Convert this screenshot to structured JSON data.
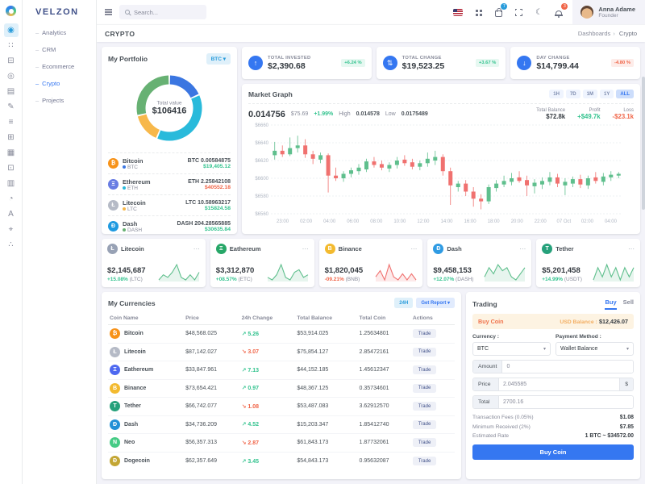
{
  "app": {
    "logo": "VELZON"
  },
  "ui": {
    "dots": "⋯",
    "chevron": "▾"
  },
  "topbar": {
    "search_placeholder": "Search...",
    "cart_badge": "7",
    "bell_badge": "3",
    "user": {
      "name": "Anna Adame",
      "role": "Founder"
    }
  },
  "sidebar": {
    "rail": [
      {
        "name": "dashboards-icon",
        "glyph": "◉",
        "state": "active"
      },
      {
        "name": "apps-icon",
        "glyph": "∷",
        "state": ""
      },
      {
        "name": "layouts-icon",
        "glyph": "⊟",
        "state": ""
      },
      {
        "name": "auth-icon",
        "glyph": "◎",
        "state": ""
      },
      {
        "name": "pages-icon",
        "glyph": "▤",
        "state": ""
      },
      {
        "name": "landing-icon",
        "glyph": "✎",
        "state": ""
      },
      {
        "name": "base-ui-icon",
        "glyph": "≡",
        "state": ""
      },
      {
        "name": "advance-ui-icon",
        "glyph": "⊞",
        "state": ""
      },
      {
        "name": "widgets-icon",
        "glyph": "▦",
        "state": ""
      },
      {
        "name": "forms-icon",
        "glyph": "⊡",
        "state": ""
      },
      {
        "name": "tables-icon",
        "glyph": "▥",
        "state": ""
      },
      {
        "name": "charts-icon",
        "glyph": "◔",
        "state": ""
      },
      {
        "name": "icons-icon",
        "glyph": "A",
        "state": ""
      },
      {
        "name": "maps-icon",
        "glyph": "⌖",
        "state": ""
      },
      {
        "name": "multilevel-icon",
        "glyph": "∴",
        "state": ""
      }
    ],
    "menu": [
      {
        "label": "Analytics",
        "state": ""
      },
      {
        "label": "CRM",
        "state": ""
      },
      {
        "label": "Ecommerce",
        "state": ""
      },
      {
        "label": "Crypto",
        "state": "active"
      },
      {
        "label": "Projects",
        "state": ""
      }
    ]
  },
  "page": {
    "title": "CRYPTO",
    "breadcrumb": [
      "Dashboards",
      "Crypto"
    ]
  },
  "portfolio": {
    "title": "My Portfolio",
    "selector": "BTC",
    "center_label": "Total value",
    "center_value": "$106416",
    "coins": [
      {
        "name": "Bitcoin",
        "symbol": "BTC",
        "icon": "₿",
        "icon_bg": "#f7931a",
        "dot": "#3b76e1",
        "amount": "BTC 0.00584875",
        "value": "$19,405.12",
        "state": "up"
      },
      {
        "name": "Ethereum",
        "symbol": "ETH",
        "icon": "Ξ",
        "icon_bg": "#687ce3",
        "dot": "#29badb",
        "amount": "ETH 2.25842108",
        "value": "$40552.18",
        "state": "down"
      },
      {
        "name": "Litecoin",
        "symbol": "LTC",
        "icon": "Ł",
        "icon_bg": "#b5bac6",
        "dot": "#f7b84b",
        "amount": "LTC 10.58963217",
        "value": "$15824.58",
        "state": "up"
      },
      {
        "name": "Dash",
        "symbol": "DASH",
        "icon": "Đ",
        "icon_bg": "#1f9ae0",
        "dot": "#67b173",
        "amount": "DASH 204.28565885",
        "value": "$30635.84",
        "state": "up"
      }
    ]
  },
  "stats": [
    {
      "icon": "↑",
      "label": "TOTAL INVESTED",
      "value": "$2,390.68",
      "badge": "+6.24 %",
      "state": "up"
    },
    {
      "icon": "⇅",
      "label": "TOTAL CHANGE",
      "value": "$19,523.25",
      "badge": "+3.67 %",
      "state": "up"
    },
    {
      "icon": "↓",
      "label": "DAY CHANGE",
      "value": "$14,799.44",
      "badge": "-4.80 %",
      "state": "down"
    }
  ],
  "market": {
    "title": "Market Graph",
    "ranges": [
      {
        "label": "1H",
        "state": ""
      },
      {
        "label": "7D",
        "state": ""
      },
      {
        "label": "1M",
        "state": ""
      },
      {
        "label": "1Y",
        "state": ""
      },
      {
        "label": "ALL",
        "state": "active"
      }
    ],
    "price": "0.014756",
    "usd": "$75.69",
    "change": "+1.99%",
    "high_label": "High",
    "high": "0.014578",
    "low_label": "Low",
    "low": "0.0175489",
    "total_balance_label": "Total Balance",
    "total_balance": "$72.8k",
    "profit_label": "Profit",
    "profit": "+$49.7k",
    "loss_label": "Loss",
    "loss": "-$23.1k"
  },
  "coin_cards": [
    {
      "name": "Litecoin",
      "icon": "Ł",
      "icon_bg": "#98a2b5",
      "value": "$2,145,687",
      "change": "+15.08%",
      "note": "(LTC)",
      "state": "up"
    },
    {
      "name": "Eathereum",
      "icon": "Ξ",
      "icon_bg": "#27a768",
      "value": "$3,312,870",
      "change": "+08.57%",
      "note": "(ETC)",
      "state": "up"
    },
    {
      "name": "Binance",
      "icon": "B",
      "icon_bg": "#f3ba2f",
      "value": "$1,820,045",
      "change": "-09.21%",
      "note": "(BNB)",
      "state": "down"
    },
    {
      "name": "Dash",
      "icon": "Đ",
      "icon_bg": "#2f9be3",
      "value": "$9,458,153",
      "change": "+12.07%",
      "note": "(DASH)",
      "state": "up"
    },
    {
      "name": "Tether",
      "icon": "T",
      "icon_bg": "#26a17b",
      "value": "$5,201,458",
      "change": "+14.99%",
      "note": "(USDT)",
      "state": "up"
    }
  ],
  "currencies": {
    "title": "My Currencies",
    "filter_label": "24H",
    "report_label": "Get Report ▾",
    "columns": [
      "Coin Name",
      "Price",
      "24h Change",
      "Total Balance",
      "Total Coin",
      "Actions"
    ],
    "action_label": "Trade",
    "rows": [
      {
        "name": "Bitcoin",
        "icon": "₿",
        "icon_bg": "#f7931a",
        "price": "$48,568.025",
        "change": "↗ 5.26",
        "state": "up",
        "balance": "$53,914.025",
        "coin": "1.25634801"
      },
      {
        "name": "Litecoin",
        "icon": "Ł",
        "icon_bg": "#b5bac6",
        "price": "$87,142.027",
        "change": "↘ 3.07",
        "state": "down",
        "balance": "$75,854.127",
        "coin": "2.85472161"
      },
      {
        "name": "Eathereum",
        "icon": "Ξ",
        "icon_bg": "#4d68f0",
        "price": "$33,847.961",
        "change": "↗ 7.13",
        "state": "up",
        "balance": "$44,152.185",
        "coin": "1.45612347"
      },
      {
        "name": "Binance",
        "icon": "B",
        "icon_bg": "#f3ba2f",
        "price": "$73,654.421",
        "change": "↗ 0.97",
        "state": "up",
        "balance": "$48,367.125",
        "coin": "0.35734601"
      },
      {
        "name": "Tether",
        "icon": "T",
        "icon_bg": "#26a17b",
        "price": "$66,742.077",
        "change": "↘ 1.08",
        "state": "down",
        "balance": "$53,487.083",
        "coin": "3.62912570"
      },
      {
        "name": "Dash",
        "icon": "Đ",
        "icon_bg": "#2290d6",
        "price": "$34,736.209",
        "change": "↗ 4.52",
        "state": "up",
        "balance": "$15,203.347",
        "coin": "1.85412740"
      },
      {
        "name": "Neo",
        "icon": "N",
        "icon_bg": "#45cb85",
        "price": "$56,357.313",
        "change": "↘ 2.87",
        "state": "down",
        "balance": "$61,843.173",
        "coin": "1.87732061"
      },
      {
        "name": "Dogecoin",
        "icon": "Ð",
        "icon_bg": "#c3a634",
        "price": "$62,357.649",
        "change": "↗ 3.45",
        "state": "up",
        "balance": "$54,843.173",
        "coin": "0.95632087"
      }
    ]
  },
  "trading": {
    "title": "Trading",
    "tabs": [
      {
        "label": "Buy",
        "state": "active"
      },
      {
        "label": "Sell",
        "state": ""
      }
    ],
    "banner_left": "Buy Coin",
    "balance_label": "USD Balance :",
    "balance_value": "$12,426.07",
    "currency_label": "Currency :",
    "currency_value": "BTC",
    "payment_label": "Payment Method :",
    "payment_value": "Wallet Balance",
    "amount_label": "Amount",
    "amount_value": "0",
    "price_label": "Price",
    "price_value": "2.045585",
    "price_suffix": "$",
    "total_label": "Total",
    "total_value": "2700.16",
    "summary": [
      {
        "label": "Transaction Fees (0.05%)",
        "value": "$1.08"
      },
      {
        "label": "Minimum Received (2%)",
        "value": "$7.85"
      },
      {
        "label": "Estimated Rate",
        "value": "1 BTC ~ $34572.00"
      }
    ],
    "submit_label": "Buy Coin"
  },
  "chart_data": [
    {
      "id": "portfolio-donut",
      "type": "pie",
      "title": "My Portfolio",
      "center_label": "Total value",
      "center_value": "$106416",
      "labels": [
        "Bitcoin",
        "Ethereum",
        "Litecoin",
        "Dash"
      ],
      "values": [
        19405.12,
        40552.18,
        15824.58,
        30635.84
      ],
      "colors": [
        "#3b76e1",
        "#29badb",
        "#f7b84b",
        "#67b173"
      ]
    },
    {
      "id": "market-candles",
      "type": "candlestick",
      "title": "Market Graph",
      "ylim": [
        6560,
        6660
      ],
      "ytick_values": [
        6560,
        6580,
        6600,
        6620,
        6640,
        6660
      ],
      "ytick_labels": [
        "$6560",
        "$6580",
        "$6600",
        "$6620",
        "$6640",
        "$6660"
      ],
      "xticks": [
        "23:00",
        "02:00",
        "04:00",
        "06:00",
        "08:00",
        "10:00",
        "12:00",
        "14:00",
        "16:00",
        "18:00",
        "20:00",
        "22:00",
        "07 Oct",
        "02:00",
        "04:00"
      ],
      "up_color": "#5fbf8d",
      "down_color": "#f0716f",
      "candles": [
        [
          6626,
          6641,
          6621,
          6631
        ],
        [
          6631,
          6637,
          6624,
          6627
        ],
        [
          6627,
          6646,
          6625,
          6634
        ],
        [
          6634,
          6648,
          6629,
          6637
        ],
        [
          6637,
          6644,
          6623,
          6627
        ],
        [
          6627,
          6631,
          6616,
          6622
        ],
        [
          6621,
          6629,
          6617,
          6626
        ],
        [
          6626,
          6628,
          6584,
          6603
        ],
        [
          6603,
          6612,
          6597,
          6600
        ],
        [
          6600,
          6608,
          6596,
          6605
        ],
        [
          6605,
          6612,
          6601,
          6609
        ],
        [
          6608,
          6616,
          6604,
          6612
        ],
        [
          6610,
          6622,
          6607,
          6619
        ],
        [
          6619,
          6624,
          6612,
          6615
        ],
        [
          6616,
          6620,
          6609,
          6612
        ],
        [
          6611,
          6618,
          6607,
          6615
        ],
        [
          6615,
          6624,
          6611,
          6620
        ],
        [
          6621,
          6626,
          6614,
          6617
        ],
        [
          6618,
          6622,
          6610,
          6613
        ],
        [
          6613,
          6620,
          6609,
          6617
        ],
        [
          6617,
          6629,
          6613,
          6622
        ],
        [
          6620,
          6631,
          6615,
          6624
        ],
        [
          6624,
          6627,
          6603,
          6608
        ],
        [
          6608,
          6612,
          6570,
          6592
        ],
        [
          6590,
          6597,
          6585,
          6594
        ],
        [
          6594,
          6598,
          6580,
          6585
        ],
        [
          6585,
          6590,
          6568,
          6577
        ],
        [
          6577,
          6582,
          6565,
          6574
        ],
        [
          6574,
          6593,
          6571,
          6590
        ],
        [
          6589,
          6598,
          6585,
          6594
        ],
        [
          6593,
          6603,
          6590,
          6597
        ],
        [
          6596,
          6606,
          6592,
          6600
        ],
        [
          6601,
          6608,
          6595,
          6597
        ],
        [
          6598,
          6603,
          6580,
          6592
        ],
        [
          6591,
          6599,
          6583,
          6595
        ],
        [
          6593,
          6601,
          6588,
          6597
        ],
        [
          6596,
          6607,
          6592,
          6601
        ],
        [
          6601,
          6605,
          6590,
          6594
        ],
        [
          6592,
          6600,
          6581,
          6596
        ],
        [
          6594,
          6602,
          6590,
          6599
        ],
        [
          6599,
          6604,
          6589,
          6593
        ],
        [
          6592,
          6603,
          6588,
          6600
        ],
        [
          6601,
          6607,
          6594,
          6597
        ],
        [
          6596,
          6606,
          6592,
          6602
        ],
        [
          6601,
          6608,
          6597,
          6604
        ],
        [
          6603,
          6607,
          6600,
          6605
        ]
      ]
    },
    {
      "id": "coin-sparklines",
      "type": "line",
      "series": [
        {
          "name": "Litecoin",
          "color": "#5fbf8d",
          "values": [
            2,
            4,
            3,
            5,
            8,
            3,
            2,
            4,
            2,
            5
          ]
        },
        {
          "name": "Eathereum",
          "color": "#5fbf8d",
          "values": [
            3,
            2,
            4,
            8,
            3,
            2,
            5,
            6,
            3,
            4
          ]
        },
        {
          "name": "Binance",
          "color": "#f0716f",
          "values": [
            3,
            5,
            2,
            7,
            3,
            2,
            4,
            2,
            4,
            2
          ]
        },
        {
          "name": "Dash",
          "color": "#5fbf8d",
          "values": [
            3,
            6,
            4,
            7,
            5,
            6,
            3,
            2,
            4,
            6
          ]
        },
        {
          "name": "Tether",
          "color": "#5fbf8d",
          "values": [
            2,
            6,
            3,
            7,
            3,
            6,
            2,
            6,
            3,
            6
          ]
        }
      ]
    }
  ]
}
